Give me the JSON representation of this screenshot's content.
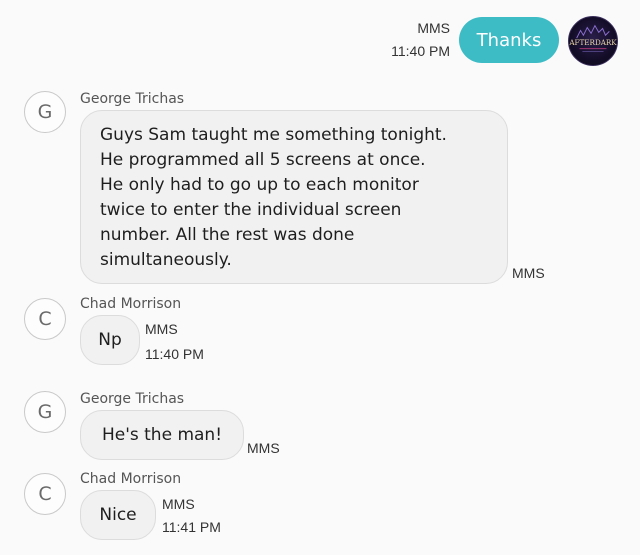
{
  "colors": {
    "outgoing_bubble": "#3dbcc6",
    "incoming_bubble": "#f1f1f1",
    "background": "#fafafa"
  },
  "outgoing": {
    "message_type": "MMS",
    "time": "11:40 PM",
    "text": "Thanks",
    "avatar_logo_text": "AFTERDARK"
  },
  "messages": [
    {
      "avatar_letter": "G",
      "sender": "George Trichas",
      "lines": [
        "Guys Sam taught me something tonight.",
        "He programmed all 5 screens at once.",
        "He only had to go up to each monitor",
        "twice to enter the individual screen",
        "number. All the rest was done",
        "simultaneously."
      ],
      "message_type": "MMS"
    },
    {
      "avatar_letter": "C",
      "sender": "Chad Morrison",
      "text": "Np",
      "message_type": "MMS",
      "time": "11:40 PM"
    },
    {
      "avatar_letter": "G",
      "sender": "George Trichas",
      "text": "He's the man!",
      "message_type": "MMS"
    },
    {
      "avatar_letter": "C",
      "sender": "Chad Morrison",
      "text": "Nice",
      "message_type": "MMS",
      "time": "11:41 PM"
    }
  ]
}
